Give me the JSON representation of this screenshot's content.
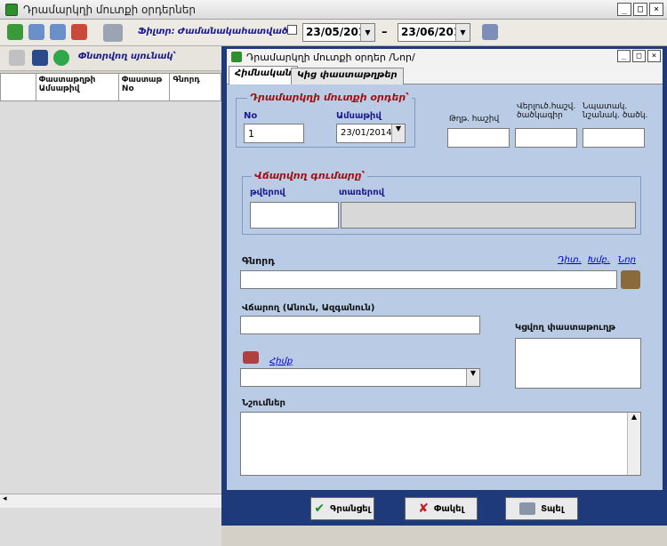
{
  "window": {
    "title": "Դրամարկղի մուտքի օրդերներ"
  },
  "toolbar": {
    "filter_label": "Ֆիլտր:",
    "filter_value": "Ժամանակահատված՝",
    "date_from": "23/05/2013",
    "date_to": "23/06/2013",
    "dash": "–"
  },
  "left": {
    "view_tab": "Փնտրվող սյունակ՝",
    "columns": [
      "Փաստաթղթի Ամսաթիվ",
      "Փաստաթ No",
      "Գնորդ"
    ]
  },
  "child": {
    "title": "Դրամարկղի մուտքի օրդեր /Նոր/",
    "tabs": [
      "Հիմնական",
      "Կից փաստաթղթեր"
    ],
    "order_group": "Դրամարկղի մուտքի օրդեր՝",
    "no_label": "No",
    "no_value": "1",
    "date_label": "Ամսաթիվ",
    "date_value": "23/01/2014",
    "corr_account": "Թղթ. հաշիվ",
    "analytic_acc": "Վերլուծ.հաշվ. ծածկագիր",
    "analytic_code": "Նպատակ. նշանակ. ծածկ.",
    "amount_group": "Վճարվող գումարը՝",
    "digits_label": "թվերով",
    "words_label": "տառերով",
    "buyer_label": "Գնորդ",
    "buyer_links": [
      "Դիտ.",
      "Խմբ.",
      "Նոր"
    ],
    "payer_label": "Վճարող (Անուն, Ազգանուն)",
    "attach_label": "Կցվող փաստաթուղթ",
    "base_link": "Հիմք",
    "note_label": "Նշումներ"
  },
  "buttons": {
    "save": "Գրանցել",
    "close": "Փակել",
    "print": "Տպել"
  }
}
